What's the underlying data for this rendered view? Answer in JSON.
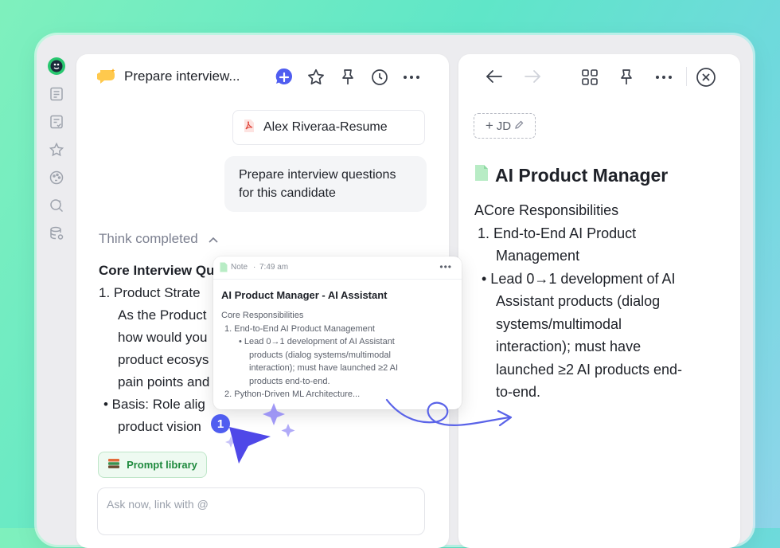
{
  "chat": {
    "title": "Prepare interview...",
    "attachment_label": "Alex Riveraa-Resume",
    "user_message_line1": "Prepare interview questions",
    "user_message_line2": "for this candidate",
    "think_status": "Think completed",
    "answer_heading": "Core Interview Qu",
    "answer_item1": "1.  Product Strate",
    "answer_line2": "As the Product",
    "answer_line3": "how would you",
    "answer_line4": "product ecosys",
    "answer_line5": "pain points and",
    "answer_bullet": "•  Basis: Role alig",
    "answer_line7": "product vision",
    "prompt_library_label": "Prompt library",
    "input_placeholder": "Ask now, link with @"
  },
  "note_card": {
    "type_label": "Note",
    "time": "7:49 am",
    "title": "AI Product Manager - AI Assistant",
    "section": "Core Responsibilities",
    "item1": "1. End-to-End AI Product Management",
    "bullet_line1": "• Lead 0→1 development of AI Assistant",
    "bullet_line2": "products (dialog systems/multimodal",
    "bullet_line3": "interaction); must have launched ≥2 AI",
    "bullet_line4": "products end-to-end.",
    "item2": "2. Python-Driven ML Architecture..."
  },
  "cursor_badge": "1",
  "document": {
    "tag_label": "JD",
    "title": "AI Product Manager",
    "section": "ACore Responsibilities",
    "item1_line1": "1.  End-to-End AI Product",
    "item1_line2": "Management",
    "bullet_line1": "•  Lead 0→1 development of AI",
    "bullet_line2": "Assistant products (dialog",
    "bullet_line3": "systems/multimodal",
    "bullet_line4": "interaction); must have",
    "bullet_line5": "launched ≥2 AI products end-",
    "bullet_line6": "to-end."
  },
  "colors": {
    "accent": "#4f5df0",
    "green": "#1f8a3e",
    "background_gradient": "#6fe8c8"
  },
  "icons": [
    "logo-icon",
    "notes-icon",
    "tasks-icon",
    "star-icon",
    "palette-icon",
    "search-icon",
    "database-icon",
    "new-chat-icon",
    "pin-icon",
    "history-icon",
    "more-icon",
    "back-arrow-icon",
    "forward-arrow-icon",
    "layout-icon",
    "close-icon",
    "pdf-icon",
    "doc-icon",
    "chevron-up-icon",
    "book-icon",
    "pencil-icon",
    "cursor-icon"
  ]
}
